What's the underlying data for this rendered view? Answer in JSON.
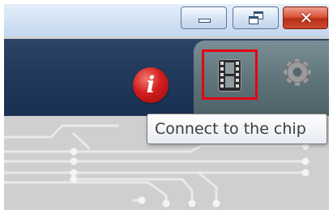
{
  "window_controls": {
    "minimize_icon": "minimize-icon",
    "restore_icon": "restore-icon",
    "close_icon": "close-icon",
    "close_glyph": "✕",
    "close_color": "#c83f25"
  },
  "toolbar": {
    "info_glyph": "i",
    "info_icon": "info-icon",
    "info_color": "#d11d1d",
    "film_icon": "film-strip-icon",
    "film_selected": true,
    "highlight_color": "#e30613",
    "gear_icon": "gear-icon",
    "bar_color": "#213a5c"
  },
  "tooltip": {
    "text": "Connect to the chip"
  }
}
